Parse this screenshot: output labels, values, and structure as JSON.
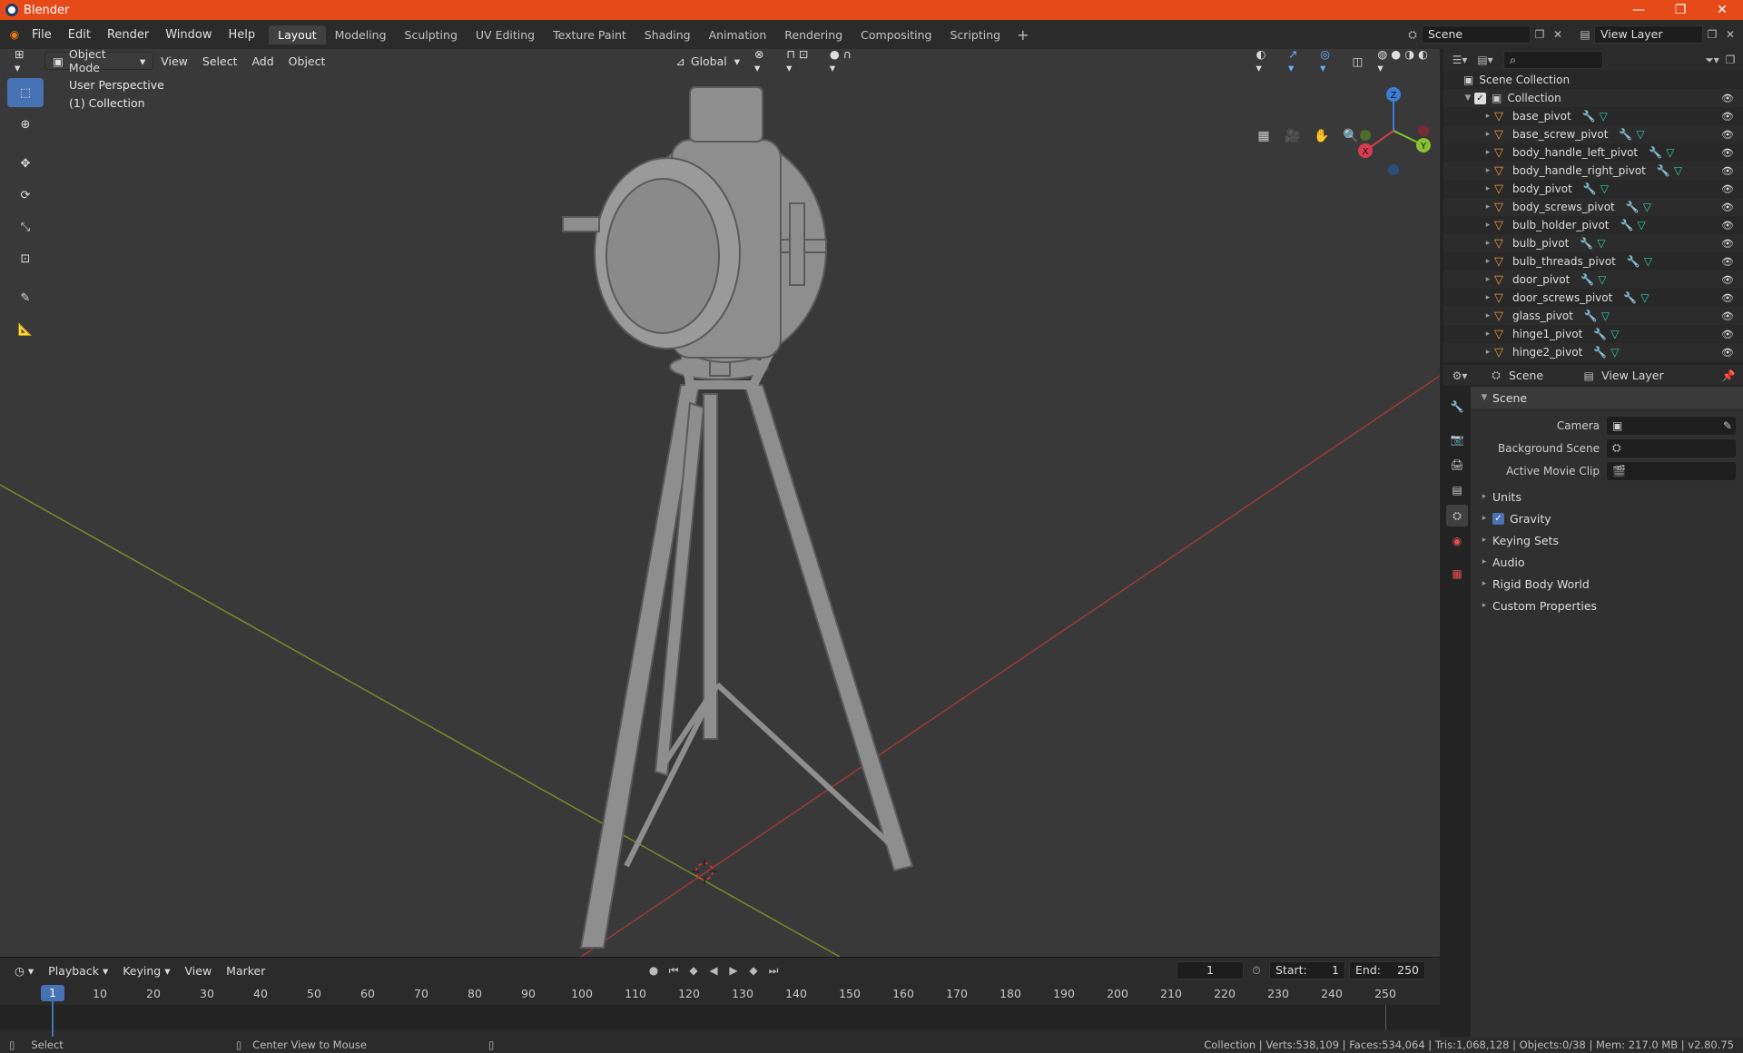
{
  "window": {
    "title": "Blender",
    "minimize": "—",
    "restore": "❐",
    "close": "✕"
  },
  "menu": [
    "File",
    "Edit",
    "Render",
    "Window",
    "Help"
  ],
  "workspaces": [
    "Layout",
    "Modeling",
    "Sculpting",
    "UV Editing",
    "Texture Paint",
    "Shading",
    "Animation",
    "Rendering",
    "Compositing",
    "Scripting"
  ],
  "active_workspace": "Layout",
  "scene_selector": "Scene",
  "view_layer_selector": "View Layer",
  "viewport": {
    "mode": "Object Mode",
    "menus": [
      "View",
      "Select",
      "Add",
      "Object"
    ],
    "transform_orientation": "Global",
    "perspective_label": "User Perspective",
    "collection_label": "(1) Collection",
    "gizmo_axes": {
      "z": "Z",
      "y": "Y",
      "x": "X"
    }
  },
  "outliner": {
    "root": "Scene Collection",
    "collection": "Collection",
    "objects": [
      "base_pivot",
      "base_screw_pivot",
      "body_handle_left_pivot",
      "body_handle_right_pivot",
      "body_pivot",
      "body_screws_pivot",
      "bulb_holder_pivot",
      "bulb_pivot",
      "bulb_threads_pivot",
      "door_pivot",
      "door_screws_pivot",
      "glass_pivot",
      "hinge1_pivot",
      "hinge2_pivot"
    ]
  },
  "properties": {
    "header_scene": "Scene",
    "header_view_layer": "View Layer",
    "panel_title": "Scene",
    "fields": [
      {
        "label": "Camera",
        "value": ""
      },
      {
        "label": "Background Scene",
        "value": ""
      },
      {
        "label": "Active Movie Clip",
        "value": ""
      }
    ],
    "subpanels": [
      "Units",
      "Gravity",
      "Keying Sets",
      "Audio",
      "Rigid Body World",
      "Custom Properties"
    ]
  },
  "timeline": {
    "menus": [
      "Playback",
      "Keying",
      "View",
      "Marker"
    ],
    "current_frame": "1",
    "start_label": "Start:",
    "start": "1",
    "end_label": "End:",
    "end": "250",
    "ticks": [
      "1",
      "10",
      "20",
      "30",
      "40",
      "50",
      "60",
      "70",
      "80",
      "90",
      "100",
      "110",
      "120",
      "130",
      "140",
      "150",
      "160",
      "170",
      "180",
      "190",
      "200",
      "210",
      "220",
      "230",
      "240",
      "250"
    ]
  },
  "statusbar": {
    "left_action": "Select",
    "middle_action": "Center View to Mouse",
    "stats": "Collection | Verts:538,109 | Faces:534,064 | Tris:1,068,128 | Objects:0/38 | Mem: 217.0 MB | v2.80.75"
  }
}
